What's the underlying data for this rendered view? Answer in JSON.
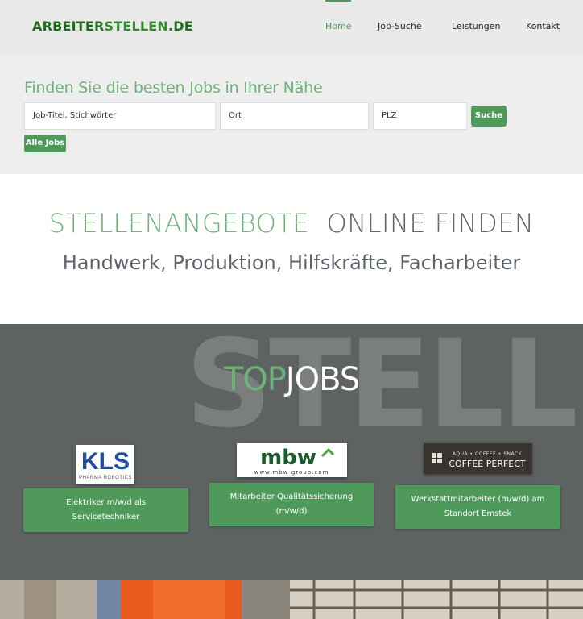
{
  "header": {
    "logo": {
      "part1": "ARBEITER",
      "part2": "STELLEN",
      "part3": ".DE"
    },
    "nav": [
      {
        "label": "Home",
        "active": true
      },
      {
        "label": "Job-Suche",
        "active": false
      },
      {
        "label": "Leistungen",
        "active": false
      },
      {
        "label": "Kontakt",
        "active": false
      }
    ]
  },
  "search": {
    "title": "Finden Sie die besten Jobs in Ihrer Nähe",
    "keywords_placeholder": "Job-Titel, Stichwörter",
    "location_placeholder": "Ort",
    "zip_placeholder": "PLZ",
    "search_button": "Suche",
    "all_jobs_button": "Alle Jobs"
  },
  "slogan": {
    "line1_green": "STELLENANGEBOTE",
    "line1_dark": "ONLINE FINDEN",
    "line2": "Handwerk, Produktion, Hilfskräfte, Facharbeiter"
  },
  "topjobs": {
    "watermark": "STELL",
    "title_green": "TOP",
    "title_white": "JOBS",
    "jobs": [
      {
        "logo_name": "kls-logo",
        "logo_text": "KLS",
        "logo_subtext": "PHARMA ROBOTICS",
        "title": "Elektriker m/w/d als Servicetechniker"
      },
      {
        "logo_name": "mbw-logo",
        "logo_text": "mbw",
        "logo_subtext": "www.mbw-group.com",
        "title": "Mitarbeiter Qualitätssicherung (m/w/d)"
      },
      {
        "logo_name": "coffee-perfect-logo",
        "logo_text": "COFFEE PERFECT",
        "logo_subtext": "AQUA • COFFEE • SNACK",
        "title": "Werkstattmitarbeiter (m/w/d) am Standort Emstek"
      }
    ]
  },
  "colors": {
    "accent": "#4f9a5a",
    "accent_light": "#6db27a",
    "logo_green": "#1d6a1d",
    "dark_section": "#5e6362"
  }
}
